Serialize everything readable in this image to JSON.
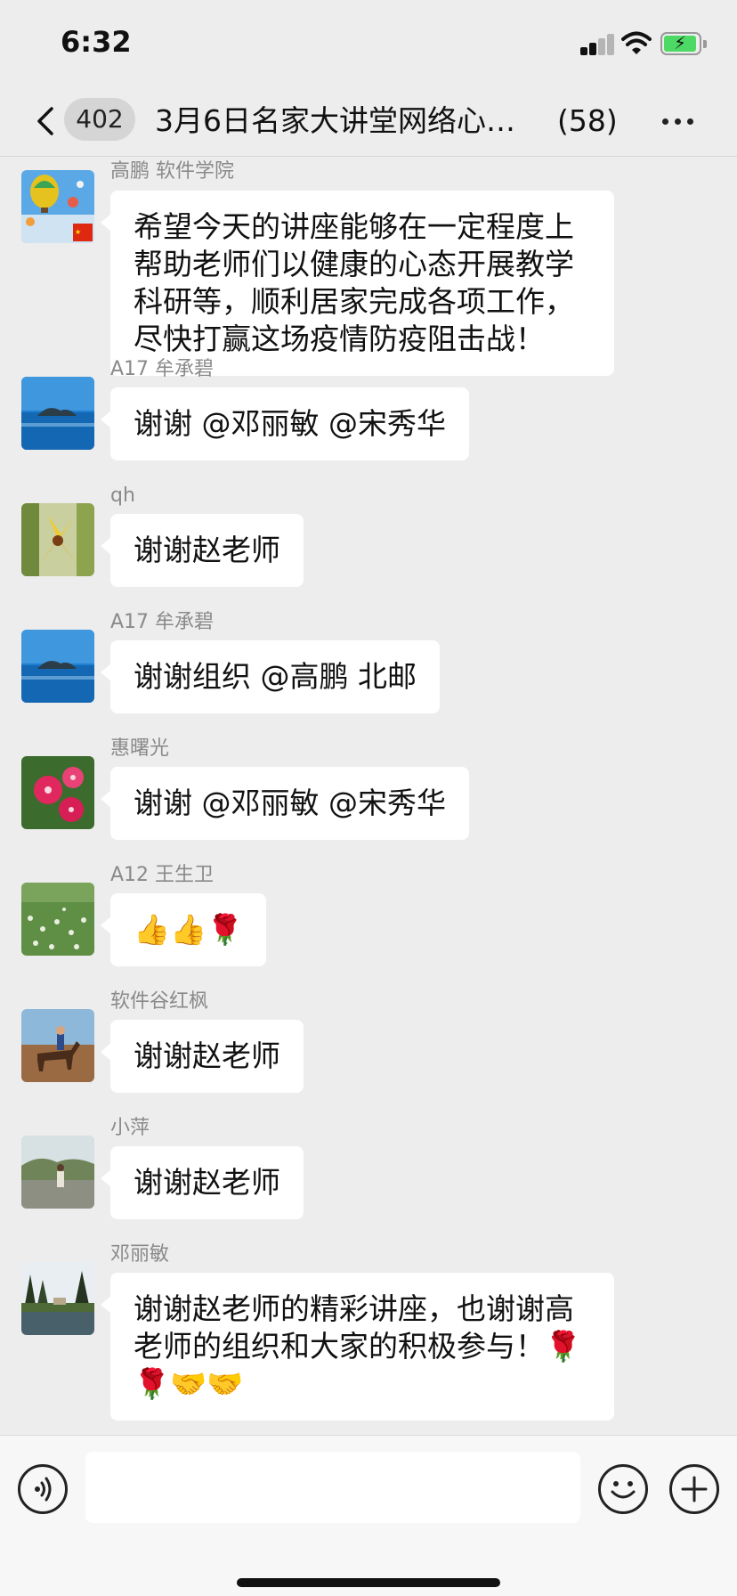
{
  "status_bar": {
    "time": "6:32"
  },
  "nav": {
    "unread_badge": "402",
    "title": "3月6日名家大讲堂网络心…",
    "member_count": "(58)"
  },
  "messages": [
    {
      "sender": "高鹏 软件学院",
      "text": "希望今天的讲座能够在一定程度上帮助老师们以健康的心态开展教学科研等，顺利居家完成各项工作，尽快打赢这场疫情防疫阻击战！",
      "avatar": "hot-air-balloons"
    },
    {
      "sender": "A17 牟承碧",
      "text": "谢谢 @邓丽敏 @宋秀华",
      "avatar": "sea-rock"
    },
    {
      "sender": "qh",
      "text": "谢谢赵老师",
      "avatar": "yellow-orchid"
    },
    {
      "sender": "A17 牟承碧",
      "text": "谢谢组织 @高鹏 北邮",
      "avatar": "sea-rock"
    },
    {
      "sender": "惠曙光",
      "text": "谢谢 @邓丽敏 @宋秀华",
      "avatar": "pink-flowers"
    },
    {
      "sender": "A12 王生卫",
      "text": "👍👍🌹",
      "avatar": "flower-field"
    },
    {
      "sender": "软件谷红枫",
      "text": "谢谢赵老师",
      "avatar": "horse-rider"
    },
    {
      "sender": "小萍",
      "text": "谢谢赵老师",
      "avatar": "garden-person"
    },
    {
      "sender": "邓丽敏",
      "text": "谢谢赵老师的精彩讲座，也谢谢高老师的组织和大家的积极参与！🌹🌹🤝🤝",
      "avatar": "lake-trees"
    }
  ],
  "input": {
    "placeholder": ""
  },
  "colors": {
    "background": "#ededed",
    "bubble": "#ffffff",
    "battery": "#4cd964"
  }
}
